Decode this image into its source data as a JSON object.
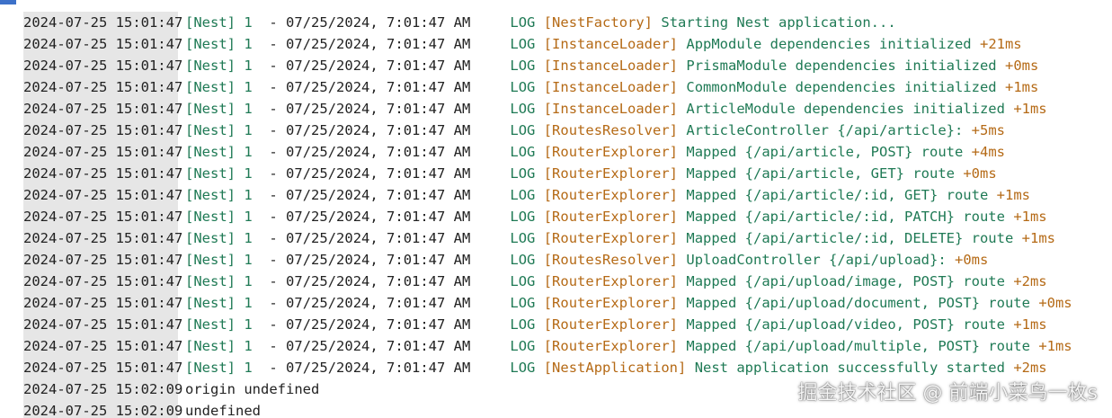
{
  "lines": [
    {
      "ts": "2024-07-25 15:01:47",
      "app": "[Nest]",
      "pid": "1",
      "dash": "-",
      "datetime": "07/25/2024, 7:01:47 AM",
      "level": "LOG",
      "context": "[NestFactory]",
      "message": "Starting Nest application...",
      "timing": ""
    },
    {
      "ts": "2024-07-25 15:01:47",
      "app": "[Nest]",
      "pid": "1",
      "dash": "-",
      "datetime": "07/25/2024, 7:01:47 AM",
      "level": "LOG",
      "context": "[InstanceLoader]",
      "message": "AppModule dependencies initialized",
      "timing": "+21ms"
    },
    {
      "ts": "2024-07-25 15:01:47",
      "app": "[Nest]",
      "pid": "1",
      "dash": "-",
      "datetime": "07/25/2024, 7:01:47 AM",
      "level": "LOG",
      "context": "[InstanceLoader]",
      "message": "PrismaModule dependencies initialized",
      "timing": "+0ms"
    },
    {
      "ts": "2024-07-25 15:01:47",
      "app": "[Nest]",
      "pid": "1",
      "dash": "-",
      "datetime": "07/25/2024, 7:01:47 AM",
      "level": "LOG",
      "context": "[InstanceLoader]",
      "message": "CommonModule dependencies initialized",
      "timing": "+1ms"
    },
    {
      "ts": "2024-07-25 15:01:47",
      "app": "[Nest]",
      "pid": "1",
      "dash": "-",
      "datetime": "07/25/2024, 7:01:47 AM",
      "level": "LOG",
      "context": "[InstanceLoader]",
      "message": "ArticleModule dependencies initialized",
      "timing": "+1ms"
    },
    {
      "ts": "2024-07-25 15:01:47",
      "app": "[Nest]",
      "pid": "1",
      "dash": "-",
      "datetime": "07/25/2024, 7:01:47 AM",
      "level": "LOG",
      "context": "[RoutesResolver]",
      "message": "ArticleController {/api/article}:",
      "timing": "+5ms"
    },
    {
      "ts": "2024-07-25 15:01:47",
      "app": "[Nest]",
      "pid": "1",
      "dash": "-",
      "datetime": "07/25/2024, 7:01:47 AM",
      "level": "LOG",
      "context": "[RouterExplorer]",
      "message": "Mapped {/api/article, POST} route",
      "timing": "+4ms"
    },
    {
      "ts": "2024-07-25 15:01:47",
      "app": "[Nest]",
      "pid": "1",
      "dash": "-",
      "datetime": "07/25/2024, 7:01:47 AM",
      "level": "LOG",
      "context": "[RouterExplorer]",
      "message": "Mapped {/api/article, GET} route",
      "timing": "+0ms"
    },
    {
      "ts": "2024-07-25 15:01:47",
      "app": "[Nest]",
      "pid": "1",
      "dash": "-",
      "datetime": "07/25/2024, 7:01:47 AM",
      "level": "LOG",
      "context": "[RouterExplorer]",
      "message": "Mapped {/api/article/:id, GET} route",
      "timing": "+1ms"
    },
    {
      "ts": "2024-07-25 15:01:47",
      "app": "[Nest]",
      "pid": "1",
      "dash": "-",
      "datetime": "07/25/2024, 7:01:47 AM",
      "level": "LOG",
      "context": "[RouterExplorer]",
      "message": "Mapped {/api/article/:id, PATCH} route",
      "timing": "+1ms"
    },
    {
      "ts": "2024-07-25 15:01:47",
      "app": "[Nest]",
      "pid": "1",
      "dash": "-",
      "datetime": "07/25/2024, 7:01:47 AM",
      "level": "LOG",
      "context": "[RouterExplorer]",
      "message": "Mapped {/api/article/:id, DELETE} route",
      "timing": "+1ms"
    },
    {
      "ts": "2024-07-25 15:01:47",
      "app": "[Nest]",
      "pid": "1",
      "dash": "-",
      "datetime": "07/25/2024, 7:01:47 AM",
      "level": "LOG",
      "context": "[RoutesResolver]",
      "message": "UploadController {/api/upload}:",
      "timing": "+0ms"
    },
    {
      "ts": "2024-07-25 15:01:47",
      "app": "[Nest]",
      "pid": "1",
      "dash": "-",
      "datetime": "07/25/2024, 7:01:47 AM",
      "level": "LOG",
      "context": "[RouterExplorer]",
      "message": "Mapped {/api/upload/image, POST} route",
      "timing": "+2ms"
    },
    {
      "ts": "2024-07-25 15:01:47",
      "app": "[Nest]",
      "pid": "1",
      "dash": "-",
      "datetime": "07/25/2024, 7:01:47 AM",
      "level": "LOG",
      "context": "[RouterExplorer]",
      "message": "Mapped {/api/upload/document, POST} route",
      "timing": "+0ms"
    },
    {
      "ts": "2024-07-25 15:01:47",
      "app": "[Nest]",
      "pid": "1",
      "dash": "-",
      "datetime": "07/25/2024, 7:01:47 AM",
      "level": "LOG",
      "context": "[RouterExplorer]",
      "message": "Mapped {/api/upload/video, POST} route",
      "timing": "+1ms"
    },
    {
      "ts": "2024-07-25 15:01:47",
      "app": "[Nest]",
      "pid": "1",
      "dash": "-",
      "datetime": "07/25/2024, 7:01:47 AM",
      "level": "LOG",
      "context": "[RouterExplorer]",
      "message": "Mapped {/api/upload/multiple, POST} route",
      "timing": "+1ms"
    },
    {
      "ts": "2024-07-25 15:01:47",
      "app": "[Nest]",
      "pid": "1",
      "dash": "-",
      "datetime": "07/25/2024, 7:01:47 AM",
      "level": "LOG",
      "context": "[NestApplication]",
      "message": "Nest application successfully started",
      "timing": "+2ms"
    }
  ],
  "plain_lines": [
    {
      "ts": "2024-07-25 15:02:09",
      "text": "origin undefined"
    },
    {
      "ts": "2024-07-25 15:02:09",
      "text": "undefined"
    }
  ],
  "watermark": "掘金技术社区 @ 前端小菜鸟一枚s",
  "colors": {
    "nest_green": "#1f7a55",
    "context_orange": "#b56a16",
    "timestamp_bg": "#e6e6e6",
    "top_bar_blue": "#3d71c9"
  }
}
